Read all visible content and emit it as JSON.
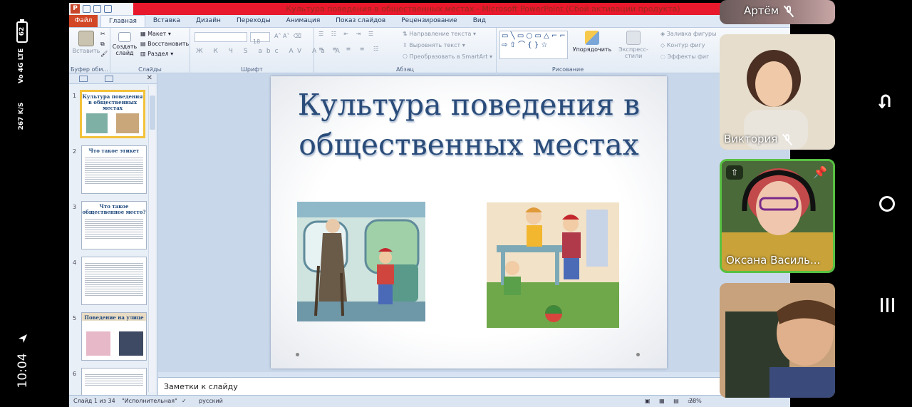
{
  "statusbar": {
    "battery": "62",
    "network": "Vo 4G LTE",
    "speed": "267 K/S",
    "time": "10:04"
  },
  "window": {
    "title": "Культура поведения в общественных местах - Microsoft PowerPoint (Сбой активации продукта)"
  },
  "tabs": {
    "file": "Файл",
    "items": [
      "Главная",
      "Вставка",
      "Дизайн",
      "Переходы",
      "Анимация",
      "Показ слайдов",
      "Рецензирование",
      "Вид"
    ]
  },
  "ribbon": {
    "clipboard": {
      "paste": "Вставить",
      "label": "Буфер обм..."
    },
    "slides": {
      "new_slide": "Создать слайд",
      "layout": "Макет",
      "reset": "Восстановить",
      "section": "Раздел",
      "label": "Слайды"
    },
    "font": {
      "size": "18",
      "glyphs": "Ж К Ч S abc AV Aa A",
      "label": "Шрифт"
    },
    "paragraph": {
      "text_direction": "Направление текста",
      "align_text": "Выровнять текст",
      "smartart": "Преобразовать в SmartArt",
      "label": "Абзац"
    },
    "drawing": {
      "shapes": "▭ ╲ ▭ ○ ▭ △ ⌐ ⌐ ⇨ ⇧ ⌒ { } ☆",
      "arrange": "Упорядочить",
      "quick_styles": "Экспресс-стили",
      "fill": "Заливка фигуры",
      "outline": "Контур фигу",
      "effects": "Эффекты фиг",
      "label": "Рисование"
    }
  },
  "thumbnails": [
    {
      "num": "1",
      "title": "Культура поведения в общественных местах"
    },
    {
      "num": "2",
      "title": "Что такое этикет"
    },
    {
      "num": "3",
      "title": "Что такое общественное место?"
    },
    {
      "num": "4",
      "title": ""
    },
    {
      "num": "5",
      "title": "Поведение на улице"
    },
    {
      "num": "6",
      "title": ""
    }
  ],
  "slide": {
    "title_line1": "Культура поведения в",
    "title_line2": "общественных местах"
  },
  "notes": {
    "placeholder": "Заметки к слайду"
  },
  "status": {
    "slide_count": "Слайд 1 из 34",
    "theme": "\"Исполнительная\"",
    "language": "русский",
    "zoom": "78%"
  },
  "participants": [
    {
      "name": "Артём"
    },
    {
      "name": "Виктория"
    },
    {
      "name": "Оксана Василь..."
    },
    {
      "name": ""
    }
  ],
  "colors": {
    "title_red": "#e8192c",
    "file_tab": "#d24726",
    "slide_title": "#2a4c7a",
    "active_speaker": "#58c142"
  }
}
